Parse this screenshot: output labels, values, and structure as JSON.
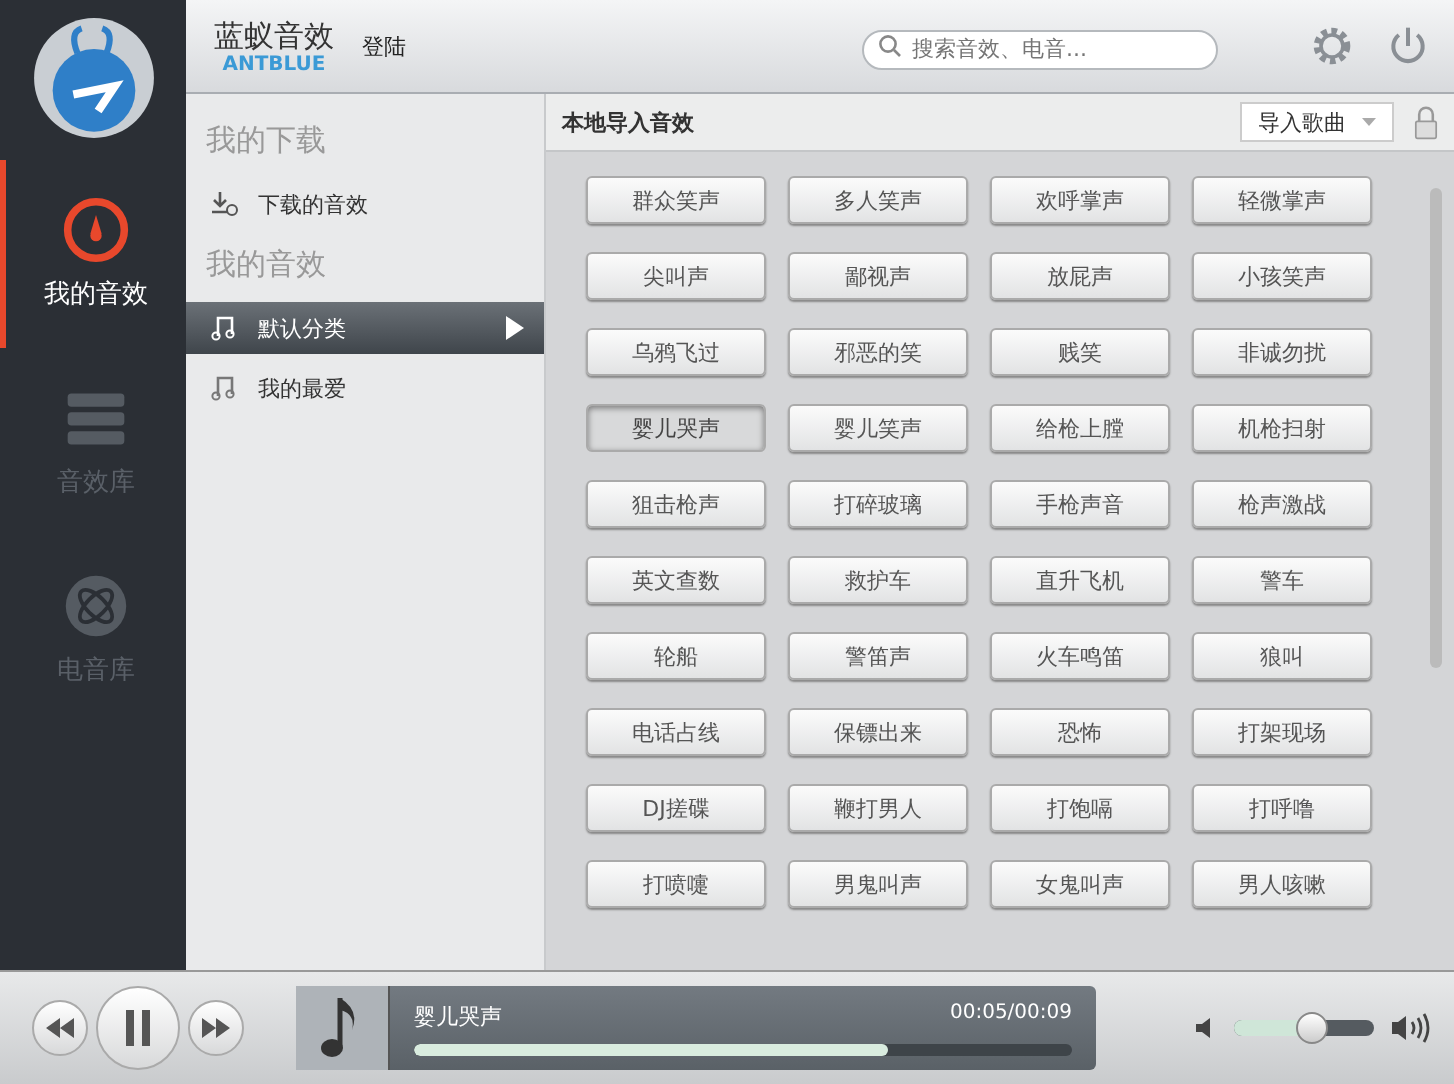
{
  "app": {
    "title": "蓝蚁音效",
    "subtitle": "ANTBLUE",
    "login": "登陆"
  },
  "search": {
    "placeholder": "搜索音效、电音..."
  },
  "nav": [
    {
      "label": "我的音效",
      "kind": "gauge",
      "selected": true
    },
    {
      "label": "音效库",
      "kind": "list",
      "selected": false
    },
    {
      "label": "电音库",
      "kind": "atom",
      "selected": false
    }
  ],
  "sidebar": {
    "sections": [
      {
        "title": "我的下载",
        "items": [
          {
            "label": "下载的音效",
            "kind": "download",
            "selected": false
          }
        ]
      },
      {
        "title": "我的音效",
        "items": [
          {
            "label": "默认分类",
            "kind": "music",
            "selected": true
          },
          {
            "label": "我的最爱",
            "kind": "music",
            "selected": false
          }
        ]
      }
    ]
  },
  "panel": {
    "title": "本地导入音效",
    "import_button": "导入歌曲"
  },
  "sounds": [
    {
      "label": "群众笑声",
      "selected": false
    },
    {
      "label": "多人笑声",
      "selected": false
    },
    {
      "label": "欢呼掌声",
      "selected": false
    },
    {
      "label": "轻微掌声",
      "selected": false
    },
    {
      "label": "尖叫声",
      "selected": false
    },
    {
      "label": "鄙视声",
      "selected": false
    },
    {
      "label": "放屁声",
      "selected": false
    },
    {
      "label": "小孩笑声",
      "selected": false
    },
    {
      "label": "乌鸦飞过",
      "selected": false
    },
    {
      "label": "邪恶的笑",
      "selected": false
    },
    {
      "label": "贱笑",
      "selected": false
    },
    {
      "label": "非诚勿扰",
      "selected": false
    },
    {
      "label": "婴儿哭声",
      "selected": true
    },
    {
      "label": "婴儿笑声",
      "selected": false
    },
    {
      "label": "给枪上膛",
      "selected": false
    },
    {
      "label": "机枪扫射",
      "selected": false
    },
    {
      "label": "狙击枪声",
      "selected": false
    },
    {
      "label": "打碎玻璃",
      "selected": false
    },
    {
      "label": "手枪声音",
      "selected": false
    },
    {
      "label": "枪声激战",
      "selected": false
    },
    {
      "label": "英文查数",
      "selected": false
    },
    {
      "label": "救护车",
      "selected": false
    },
    {
      "label": "直升飞机",
      "selected": false
    },
    {
      "label": "警车",
      "selected": false
    },
    {
      "label": "轮船",
      "selected": false
    },
    {
      "label": "警笛声",
      "selected": false
    },
    {
      "label": "火车鸣笛",
      "selected": false
    },
    {
      "label": "狼叫",
      "selected": false
    },
    {
      "label": "电话占线",
      "selected": false
    },
    {
      "label": "保镖出来",
      "selected": false
    },
    {
      "label": "恐怖",
      "selected": false
    },
    {
      "label": "打架现场",
      "selected": false
    },
    {
      "label": "DJ搓碟",
      "selected": false
    },
    {
      "label": "鞭打男人",
      "selected": false
    },
    {
      "label": "打饱嗝",
      "selected": false
    },
    {
      "label": "打呼噜",
      "selected": false
    },
    {
      "label": "打喷嚏",
      "selected": false
    },
    {
      "label": "男鬼叫声",
      "selected": false
    },
    {
      "label": "女鬼叫声",
      "selected": false
    },
    {
      "label": "男人咳嗽",
      "selected": false
    }
  ],
  "player": {
    "track": "婴儿哭声",
    "time": "00:05/00:09",
    "progress": {
      "level": 0.72
    },
    "volume": {
      "level": 0.55
    },
    "playing": true
  }
}
